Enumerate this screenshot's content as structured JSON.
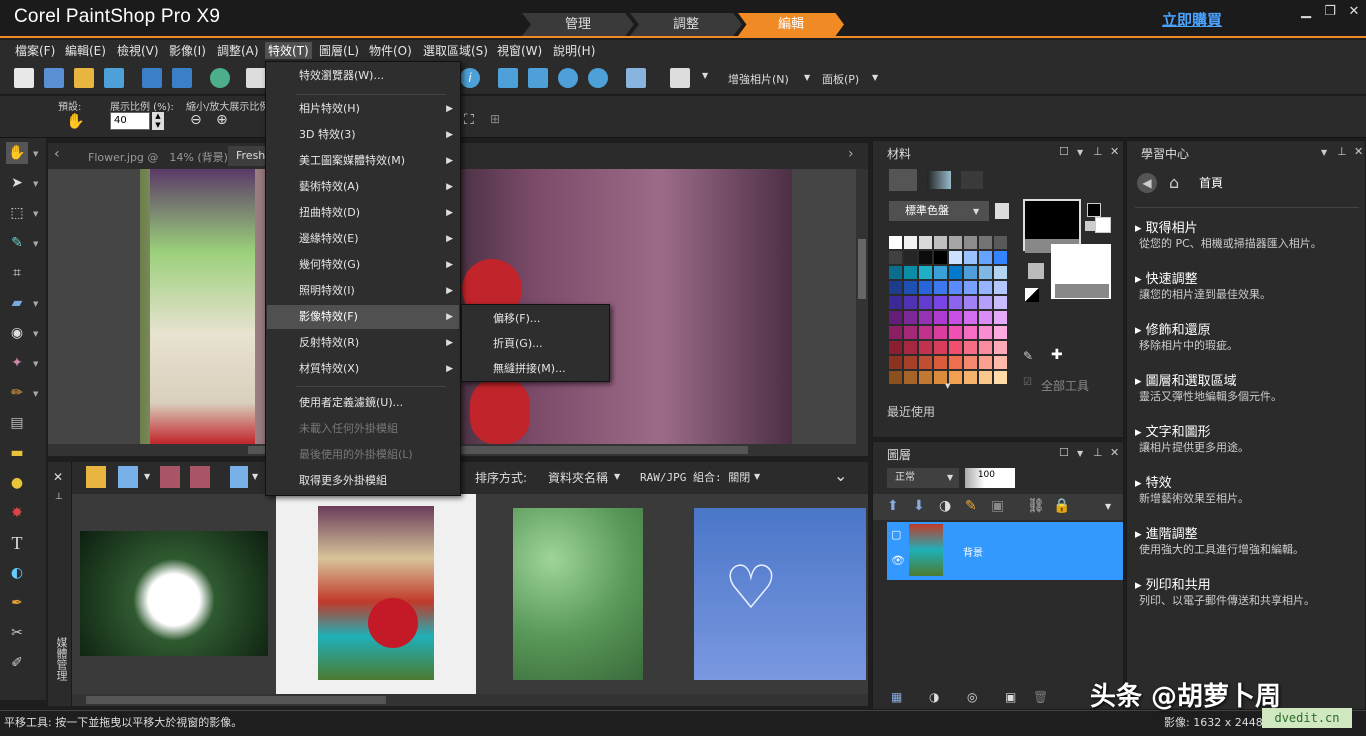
{
  "app": {
    "title": "Corel PaintShop Pro X9",
    "buy_label": "立即購買"
  },
  "modes": [
    {
      "label": "管理"
    },
    {
      "label": "調整"
    },
    {
      "label": "編輯"
    }
  ],
  "menubar": [
    {
      "label": "檔案(F)"
    },
    {
      "label": "編輯(E)"
    },
    {
      "label": "檢視(V)"
    },
    {
      "label": "影像(I)"
    },
    {
      "label": "調整(A)"
    },
    {
      "label": "特效(T)"
    },
    {
      "label": "圖層(L)"
    },
    {
      "label": "物件(O)"
    },
    {
      "label": "選取區域(S)"
    },
    {
      "label": "視窗(W)"
    },
    {
      "label": "說明(H)"
    }
  ],
  "toolbar": {
    "enhance_label": "增強相片(N)",
    "panels_label": "面板(P)"
  },
  "options": {
    "preset_label": "預設:",
    "zoom_label": "展示比例 (%):",
    "zoom_value": "40",
    "zoom_more_label": "縮小/放大展示比例:"
  },
  "doc_tabs": [
    {
      "label": "Flower.jpg @　14% (背景)"
    },
    {
      "label": "Fresh..."
    }
  ],
  "effects_menu": {
    "items": [
      {
        "label": "特效瀏覽器(W)..."
      },
      {
        "label": "相片特效(H)"
      },
      {
        "label": "3D 特效(3)"
      },
      {
        "label": "美工圖案媒體特效(M)"
      },
      {
        "label": "藝術特效(A)"
      },
      {
        "label": "扭曲特效(D)"
      },
      {
        "label": "邊緣特效(E)"
      },
      {
        "label": "幾何特效(G)"
      },
      {
        "label": "照明特效(I)"
      },
      {
        "label": "影像特效(F)"
      },
      {
        "label": "反射特效(R)"
      },
      {
        "label": "材質特效(X)"
      },
      {
        "label": "使用者定義濾鏡(U)..."
      },
      {
        "label": "未載入任何外掛模組"
      },
      {
        "label": "最後使用的外掛模組(L)"
      },
      {
        "label": "取得更多外掛模組"
      }
    ],
    "submenu": [
      {
        "label": "偏移(F)..."
      },
      {
        "label": "折頁(G)..."
      },
      {
        "label": "無縫拼接(M)..."
      }
    ]
  },
  "organizer": {
    "sort_label": "排序方式:",
    "sort_value": "資料夾名稱",
    "raw_label": "RAW/JPG 組合: 關閉",
    "side_label": "媒體管理"
  },
  "materials": {
    "title": "材料",
    "palette_label": "標準色盤",
    "all_tools_label": "全部工具",
    "recent_label": "最近使用"
  },
  "layers": {
    "title": "圖層",
    "blend_mode": "正常",
    "opacity": "100",
    "layer_name": "背景"
  },
  "learning": {
    "title": "學習中心",
    "home_label": "首頁",
    "items": [
      {
        "title": "取得相片",
        "desc": "從您的 PC、相機或掃描器匯入相片。"
      },
      {
        "title": "快速調整",
        "desc": "讓您的相片達到最佳效果。"
      },
      {
        "title": "修飾和還原",
        "desc": "移除相片中的瑕疵。"
      },
      {
        "title": "圖層和選取區域",
        "desc": "靈活又彈性地編輯多個元件。"
      },
      {
        "title": "文字和圖形",
        "desc": "讓相片提供更多用途。"
      },
      {
        "title": "特效",
        "desc": "新增藝術效果至相片。"
      },
      {
        "title": "進階調整",
        "desc": "使用強大的工具進行增強和編輯。"
      },
      {
        "title": "列印和共用",
        "desc": "列印、以電子郵件傳送和共享相片。"
      }
    ]
  },
  "status": {
    "text": "平移工具: 按一下並拖曳以平移大於視窗的影像。",
    "image_info": "影像: 1632 x 2448"
  },
  "watermark": {
    "text": "头条 @胡萝卜周",
    "site": "dvedit.cn"
  },
  "colors": {
    "accent": "#f08a24",
    "link": "#4aa3ff",
    "selection": "#3399ff"
  }
}
